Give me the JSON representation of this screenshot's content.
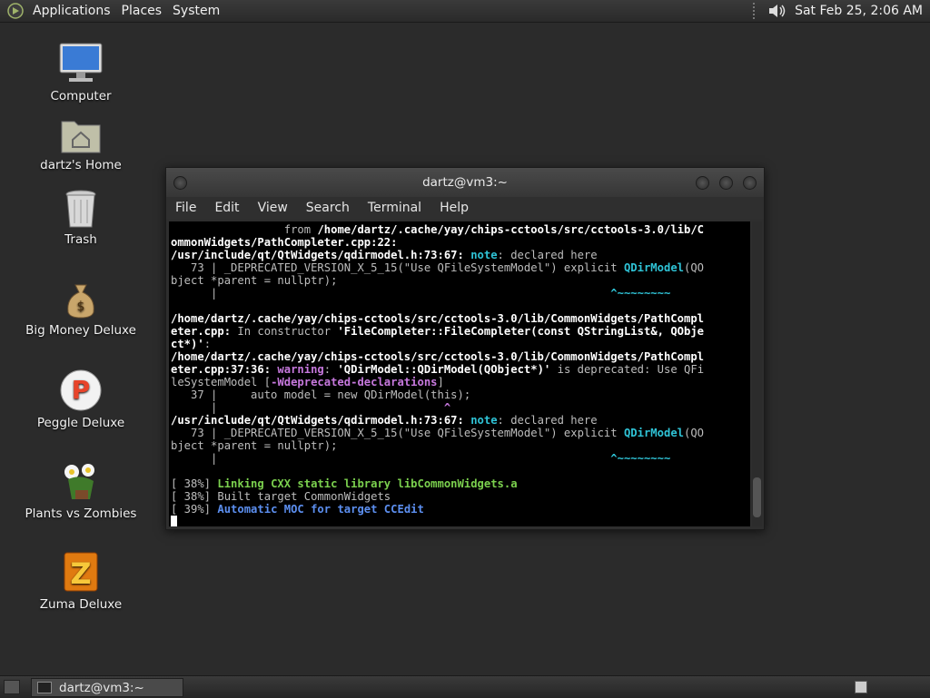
{
  "top_panel": {
    "menus": [
      "Applications",
      "Places",
      "System"
    ],
    "clock": "Sat Feb 25,  2:06 AM"
  },
  "desktop_icons": [
    {
      "label": "Computer",
      "icon": "computer-icon"
    },
    {
      "label": "dartz's Home",
      "icon": "home-folder-icon"
    },
    {
      "label": "Trash",
      "icon": "trash-icon"
    },
    {
      "label": "Big Money Deluxe",
      "icon": "money-bag-icon"
    },
    {
      "label": "Peggle Deluxe",
      "icon": "peggle-icon"
    },
    {
      "label": "Plants vs Zombies",
      "icon": "plants-icon"
    },
    {
      "label": "Zuma Deluxe",
      "icon": "zuma-icon"
    }
  ],
  "terminal": {
    "title": "dartz@vm3:~",
    "menus": [
      "File",
      "Edit",
      "View",
      "Search",
      "Terminal",
      "Help"
    ],
    "lines": [
      [
        {
          "t": "                 from ",
          "c": "g"
        },
        {
          "t": "/home/dartz/.cache/yay/chips-cctools/src/cctools-3.0/lib/C",
          "c": "b"
        }
      ],
      [
        {
          "t": "ommonWidgets/PathCompleter.cpp:22:",
          "c": "b"
        }
      ],
      [
        {
          "t": "/usr/include/qt/QtWidgets/qdirmodel.h:73:67: ",
          "c": "b"
        },
        {
          "t": "note",
          "c": "cyan"
        },
        {
          "t": ": declared here",
          "c": "g"
        }
      ],
      [
        {
          "t": "   73 | _DEPRECATED_VERSION_X_5_15(\"Use QFileSystemModel\") explicit ",
          "c": "g"
        },
        {
          "t": "QDirModel",
          "c": "cyan"
        },
        {
          "t": "(QO",
          "c": "g"
        }
      ],
      [
        {
          "t": "bject *parent = nullptr);",
          "c": "g"
        }
      ],
      [
        {
          "t": "      |                                                           ",
          "c": "g"
        },
        {
          "t": "^~~~~~~~~",
          "c": "cyan"
        }
      ],
      [
        {
          "t": "",
          "c": "g"
        }
      ],
      [
        {
          "t": "/home/dartz/.cache/yay/chips-cctools/src/cctools-3.0/lib/CommonWidgets/PathCompl",
          "c": "b"
        }
      ],
      [
        {
          "t": "eter.cpp:",
          "c": "b"
        },
        {
          "t": " In constructor ",
          "c": "g"
        },
        {
          "t": "'FileCompleter::FileCompleter(const QStringList&, QObje",
          "c": "b"
        }
      ],
      [
        {
          "t": "ct*)'",
          "c": "b"
        },
        {
          "t": ":",
          "c": "g"
        }
      ],
      [
        {
          "t": "/home/dartz/.cache/yay/chips-cctools/src/cctools-3.0/lib/CommonWidgets/PathCompl",
          "c": "b"
        }
      ],
      [
        {
          "t": "eter.cpp:37:36: ",
          "c": "b"
        },
        {
          "t": "warning",
          "c": "mag"
        },
        {
          "t": ": ",
          "c": "g"
        },
        {
          "t": "'QDirModel::QDirModel(QObject*)'",
          "c": "b"
        },
        {
          "t": " is deprecated: Use QFi",
          "c": "g"
        }
      ],
      [
        {
          "t": "leSystemModel [",
          "c": "g"
        },
        {
          "t": "-Wdeprecated-declarations",
          "c": "mag"
        },
        {
          "t": "]",
          "c": "g"
        }
      ],
      [
        {
          "t": "   37 |     auto model = new QDirModel(this);",
          "c": "g"
        }
      ],
      [
        {
          "t": "      |                                  ",
          "c": "g"
        },
        {
          "t": "^",
          "c": "mag"
        }
      ],
      [
        {
          "t": "/usr/include/qt/QtWidgets/qdirmodel.h:73:67: ",
          "c": "b"
        },
        {
          "t": "note",
          "c": "cyan"
        },
        {
          "t": ": declared here",
          "c": "g"
        }
      ],
      [
        {
          "t": "   73 | _DEPRECATED_VERSION_X_5_15(\"Use QFileSystemModel\") explicit ",
          "c": "g"
        },
        {
          "t": "QDirModel",
          "c": "cyan"
        },
        {
          "t": "(QO",
          "c": "g"
        }
      ],
      [
        {
          "t": "bject *parent = nullptr);",
          "c": "g"
        }
      ],
      [
        {
          "t": "      |                                                           ",
          "c": "g"
        },
        {
          "t": "^~~~~~~~~",
          "c": "cyan"
        }
      ],
      [
        {
          "t": "",
          "c": "g"
        }
      ],
      [
        {
          "t": "[ 38%] ",
          "c": "g"
        },
        {
          "t": "Linking CXX static library libCommonWidgets.a",
          "c": "grn"
        }
      ],
      [
        {
          "t": "[ 38%] Built target CommonWidgets",
          "c": "g"
        }
      ],
      [
        {
          "t": "[ 39%] ",
          "c": "g"
        },
        {
          "t": "Automatic MOC for target CCEdit",
          "c": "blu"
        }
      ]
    ]
  },
  "taskbar": {
    "task_label": "dartz@vm3:~"
  }
}
